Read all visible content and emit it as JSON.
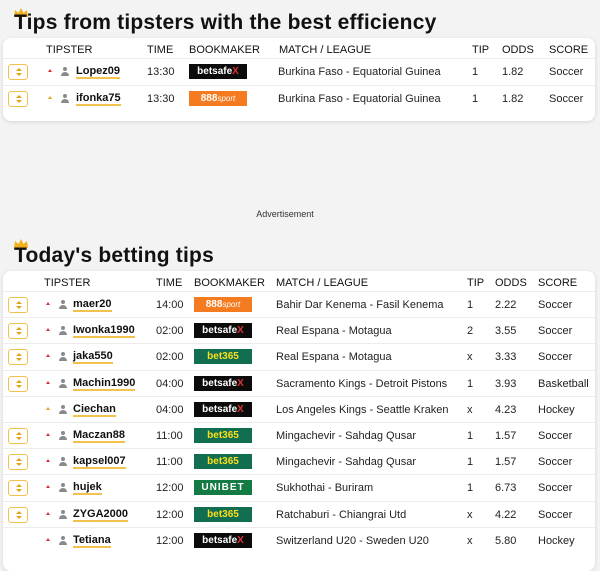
{
  "section1": {
    "title": "Tips from tipsters with the best efficiency",
    "headers": {
      "tipster": "TIPSTER",
      "time": "TIME",
      "bookmaker": "BOOKMAKER",
      "match": "MATCH / LEAGUE",
      "tip": "TIP",
      "odds": "ODDS",
      "score": "SCORE"
    },
    "rows": [
      {
        "arrow": "down",
        "tipster": "Lopez09",
        "time": "13:30",
        "bookmaker": "betsafe",
        "match": "Burkina Faso - Equatorial Guinea",
        "tip": "1",
        "odds": "1.82",
        "score": "Soccer"
      },
      {
        "arrow": "up",
        "tipster": "ifonka75",
        "time": "13:30",
        "bookmaker": "888sport",
        "match": "Burkina Faso - Equatorial Guinea",
        "tip": "1",
        "odds": "1.82",
        "score": "Soccer"
      }
    ]
  },
  "advertisement": "Advertisement",
  "section2": {
    "title": "Today's betting tips",
    "headers": {
      "tipster": "TIPSTER",
      "time": "TIME",
      "bookmaker": "BOOKMAKER",
      "match": "MATCH / LEAGUE",
      "tip": "TIP",
      "odds": "ODDS",
      "score": "SCORE"
    },
    "rows": [
      {
        "expand": true,
        "arrow": "down",
        "tipster": "maer20",
        "time": "14:00",
        "bookmaker": "888sport",
        "match": "Bahir Dar Kenema - Fasil Kenema",
        "tip": "1",
        "odds": "2.22",
        "score": "Soccer"
      },
      {
        "expand": true,
        "arrow": "down",
        "tipster": "Iwonka1990",
        "time": "02:00",
        "bookmaker": "betsafe",
        "match": "Real Espana - Motagua",
        "tip": "2",
        "odds": "3.55",
        "score": "Soccer"
      },
      {
        "expand": true,
        "arrow": "down",
        "tipster": "jaka550",
        "time": "02:00",
        "bookmaker": "bet365",
        "match": "Real Espana - Motagua",
        "tip": "x",
        "odds": "3.33",
        "score": "Soccer"
      },
      {
        "expand": true,
        "arrow": "down",
        "tipster": "Machin1990",
        "time": "04:00",
        "bookmaker": "betsafe",
        "match": "Sacramento Kings - Detroit Pistons",
        "tip": "1",
        "odds": "3.93",
        "score": "Basketball"
      },
      {
        "expand": false,
        "arrow": "up",
        "tipster": "Ciechan",
        "time": "04:00",
        "bookmaker": "betsafe",
        "match": "Los Angeles Kings - Seattle Kraken",
        "tip": "x",
        "odds": "4.23",
        "score": "Hockey"
      },
      {
        "expand": true,
        "arrow": "down",
        "tipster": "Maczan88",
        "time": "11:00",
        "bookmaker": "bet365",
        "match": "Mingachevir - Sahdag Qusar",
        "tip": "1",
        "odds": "1.57",
        "score": "Soccer"
      },
      {
        "expand": true,
        "arrow": "down",
        "tipster": "kapsel007",
        "time": "11:00",
        "bookmaker": "bet365",
        "match": "Mingachevir - Sahdag Qusar",
        "tip": "1",
        "odds": "1.57",
        "score": "Soccer"
      },
      {
        "expand": true,
        "arrow": "down",
        "tipster": "hujek",
        "time": "12:00",
        "bookmaker": "unibet",
        "match": "Sukhothai - Buriram",
        "tip": "1",
        "odds": "6.73",
        "score": "Soccer"
      },
      {
        "expand": true,
        "arrow": "down",
        "tipster": "ZYGA2000",
        "time": "12:00",
        "bookmaker": "bet365",
        "match": "Ratchaburi - Chiangrai Utd",
        "tip": "x",
        "odds": "4.22",
        "score": "Soccer"
      },
      {
        "expand": false,
        "arrow": "down",
        "tipster": "Tetiana",
        "time": "12:00",
        "bookmaker": "betsafe",
        "match": "Switzerland U20 - Sweden U20",
        "tip": "x",
        "odds": "5.80",
        "score": "Hockey"
      }
    ]
  },
  "bookmaker_logos": {
    "betsafe": {
      "text": "betsafe",
      "mark": "X",
      "color": "#0b0b0b"
    },
    "888sport": {
      "text": "888",
      "suffix": "sport",
      "color": "#f47b20"
    },
    "bet365": {
      "text": "bet365",
      "color": "#126e51"
    },
    "unibet": {
      "text": "UNIBET",
      "color": "#147b45"
    }
  },
  "colors": {
    "accent": "#f2c14e",
    "down": "#d9303a",
    "up": "#e0a21a"
  }
}
